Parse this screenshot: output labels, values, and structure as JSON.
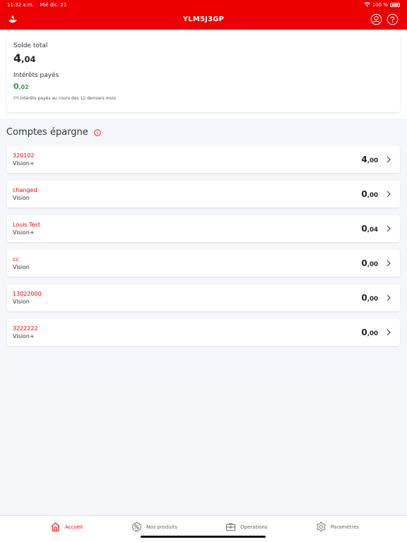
{
  "status": {
    "time": "11:32 a.m.",
    "date": "Mié dic. 21",
    "battery": "100 %"
  },
  "header": {
    "title": "YLM5J3GP",
    "icons": [
      "santander-flame-icon",
      "user-icon",
      "help-icon"
    ]
  },
  "summary": {
    "total_label": "Solde total",
    "total_int": "4",
    "total_dec": ",04",
    "interest_label": "Intérêts payés",
    "interest_int": "0",
    "interest_dec": ",02",
    "note": "(*) Intérêts payés au cours des 12 derniers mois"
  },
  "section": {
    "title": "Comptes épargne",
    "icon": "info-icon"
  },
  "accounts": [
    {
      "name": "320102",
      "type": "Vision+",
      "amount_int": "4",
      "amount_dec": ",00"
    },
    {
      "name": "changed",
      "type": "Vision",
      "amount_int": "0",
      "amount_dec": ",00"
    },
    {
      "name": "Louis Test",
      "type": "Vision+",
      "amount_int": "0",
      "amount_dec": ",04"
    },
    {
      "name": "cc",
      "type": "Vision",
      "amount_int": "0",
      "amount_dec": ",00"
    },
    {
      "name": "13022000",
      "type": "Vision",
      "amount_int": "0",
      "amount_dec": ",00"
    },
    {
      "name": "3222222",
      "type": "Vision+",
      "amount_int": "0",
      "amount_dec": ",00"
    }
  ],
  "tabs": [
    {
      "label": "Accueil",
      "icon": "home-icon",
      "active": true
    },
    {
      "label": "Nos produits",
      "icon": "percent-icon",
      "active": false
    },
    {
      "label": "Operations",
      "icon": "briefcase-icon",
      "active": false
    },
    {
      "label": "Paramètres",
      "icon": "gear-icon",
      "active": false
    }
  ],
  "colors": {
    "brand": "#ec0000",
    "positive": "#2e9b3e",
    "background": "#f4f6fa"
  }
}
